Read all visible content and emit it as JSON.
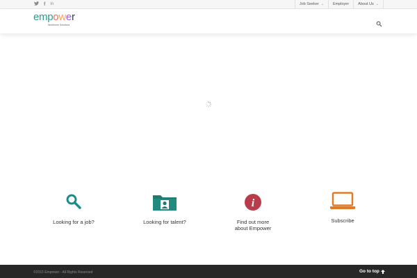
{
  "topbar": {
    "social": [
      {
        "icon": "twitter-icon",
        "glyph": "🐦"
      },
      {
        "icon": "facebook-icon",
        "glyph": "f"
      },
      {
        "icon": "linkedin-icon",
        "glyph": "in"
      }
    ],
    "nav": [
      {
        "label": "Job Seeker",
        "dropdown": true
      },
      {
        "label": "Employer",
        "dropdown": false
      },
      {
        "label": "About Us",
        "dropdown": true
      }
    ]
  },
  "header": {
    "logo": {
      "letters": [
        {
          "ch": "e",
          "color": "#2a9d8f"
        },
        {
          "ch": "m",
          "color": "#2a9d8f"
        },
        {
          "ch": "p",
          "color": "#2a9d8f"
        },
        {
          "ch": "o",
          "color": "#e76f51"
        },
        {
          "ch": "w",
          "color": "#f4a261"
        },
        {
          "ch": "e",
          "color": "#9b5de5"
        },
        {
          "ch": "r",
          "color": "#264653"
        }
      ],
      "tagline": "Workforce Solutions"
    },
    "search_icon": "search-icon"
  },
  "features": [
    {
      "icon": "search-icon",
      "label": "Looking for a job?",
      "color": "#1f8a8a"
    },
    {
      "icon": "folder-user-icon",
      "label": "Looking for talent?",
      "color": "#1f7a72"
    },
    {
      "icon": "info-icon",
      "label_lines": [
        "Find out more",
        "about Empower"
      ],
      "color": "#b83c4a"
    },
    {
      "icon": "laptop-icon",
      "label": "Subscribe",
      "color": "#e07b2a"
    }
  ],
  "footer": {
    "copyright": "©2015 Empower - All Rights Reserved",
    "go_to_top": "Go to top",
    "go_to_top_icon": "arrow-up-icon"
  },
  "colors": {
    "accent_teal": "#1f8a8a",
    "footer_bg": "#272727"
  }
}
